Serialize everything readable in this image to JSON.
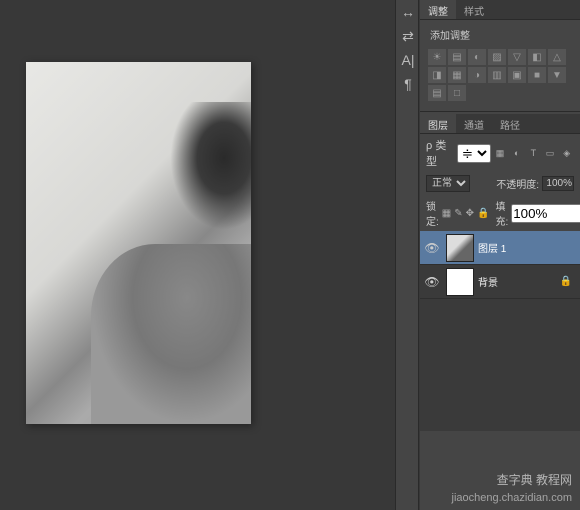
{
  "tools": {
    "t1": "↔",
    "t2": "⇄",
    "t3": "A|",
    "t4": "¶"
  },
  "adjust": {
    "tab1": "调整",
    "tab2": "样式",
    "title": "添加调整",
    "icons": [
      "☀",
      "▤",
      "◐",
      "▨",
      "▽",
      "◧",
      "△",
      "◨",
      "▦",
      "◑",
      "▥",
      "▣",
      "■",
      "▼",
      "▤",
      "□"
    ]
  },
  "layers": {
    "tab1": "图层",
    "tab2": "通道",
    "tab3": "路径",
    "kind_label": "ρ 类型",
    "blend_mode": "正常",
    "opacity_label": "不透明度:",
    "opacity_value": "100%",
    "lock_label": "锁定:",
    "fill_label": "填充:",
    "fill_value": "100%",
    "items": [
      {
        "name": "图层 1",
        "selected": true,
        "thumb": "checker"
      },
      {
        "name": "背景",
        "selected": false,
        "thumb": "white",
        "locked": true
      }
    ]
  },
  "watermark": {
    "line1": "查字典 教程网",
    "line2": "jiaocheng.chazidian.com"
  }
}
